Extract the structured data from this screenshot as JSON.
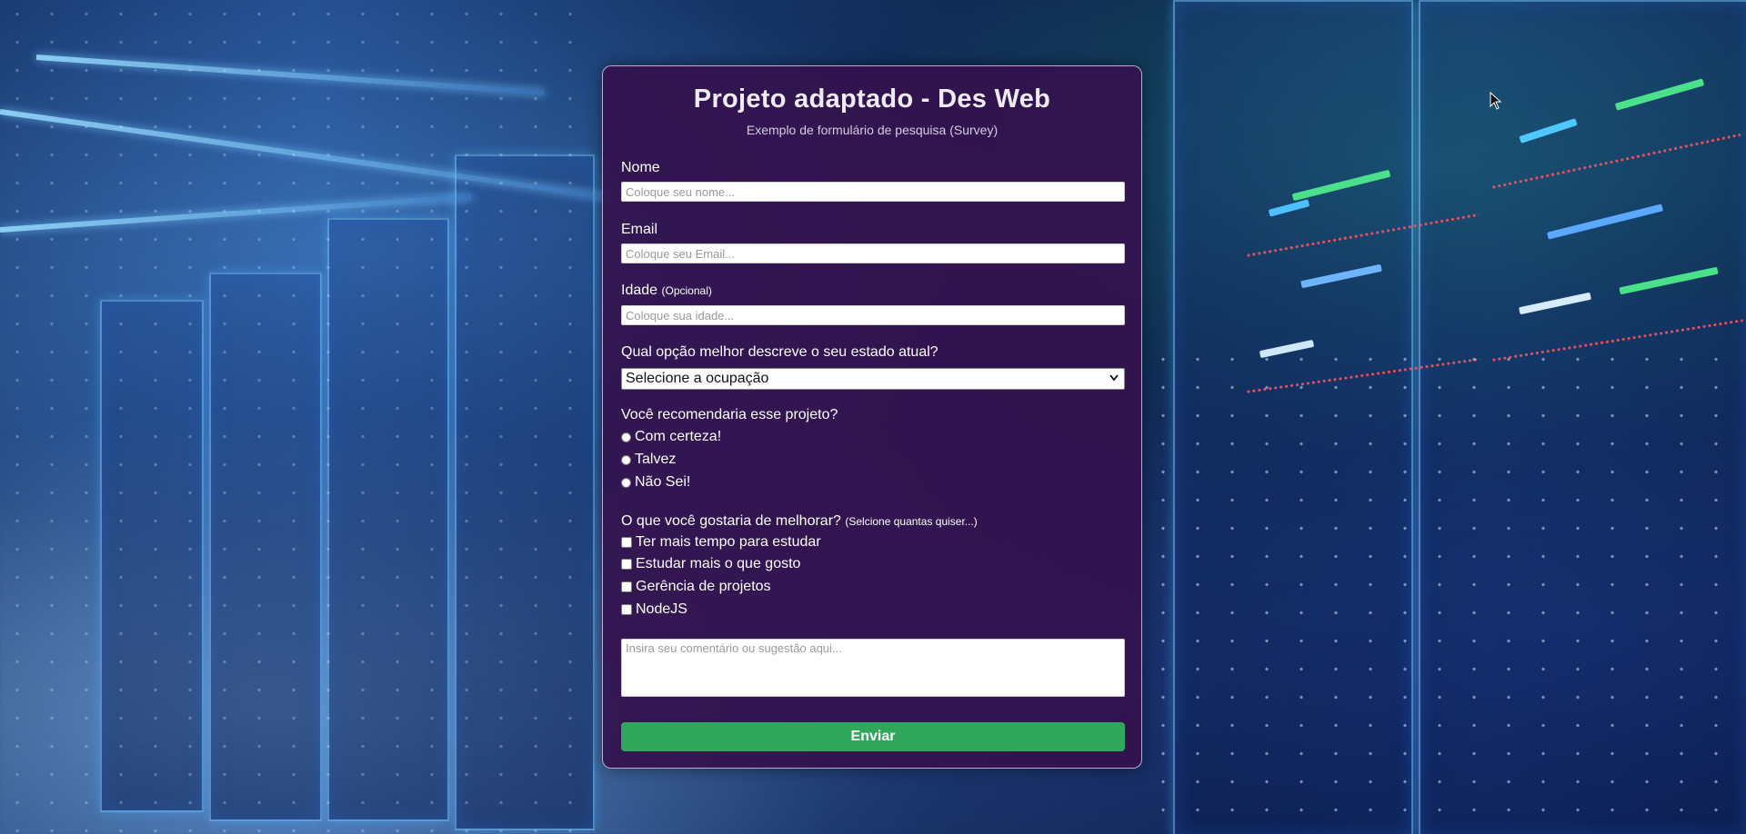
{
  "form": {
    "title": "Projeto adaptado - Des Web",
    "subtitle": "Exemplo de formulário de pesquisa (Survey)",
    "name": {
      "label": "Nome",
      "placeholder": "Coloque seu nome..."
    },
    "email": {
      "label": "Email",
      "placeholder": "Coloque seu Email..."
    },
    "age": {
      "label": "Idade",
      "hint": "(Opcional)",
      "placeholder": "Coloque sua idade..."
    },
    "occupation": {
      "label": "Qual opção melhor descreve o seu estado atual?",
      "selected": "Selecione a ocupação"
    },
    "recommend": {
      "label": "Você recomendaria esse projeto?",
      "options": [
        "Com certeza!",
        "Talvez",
        "Não Sei!"
      ]
    },
    "improve": {
      "label": "O que você gostaria de melhorar?",
      "hint": "(Selcione quantas quiser...)",
      "options": [
        "Ter mais tempo para estudar",
        "Estudar mais o que gosto",
        "Gerência de projetos",
        "NodeJS"
      ]
    },
    "comment": {
      "placeholder": "Insira seu comentário ou sugestão aqui..."
    },
    "submit_label": "Enviar"
  },
  "colors": {
    "card_background": "#34124e",
    "submit_button": "#2fa85c"
  }
}
